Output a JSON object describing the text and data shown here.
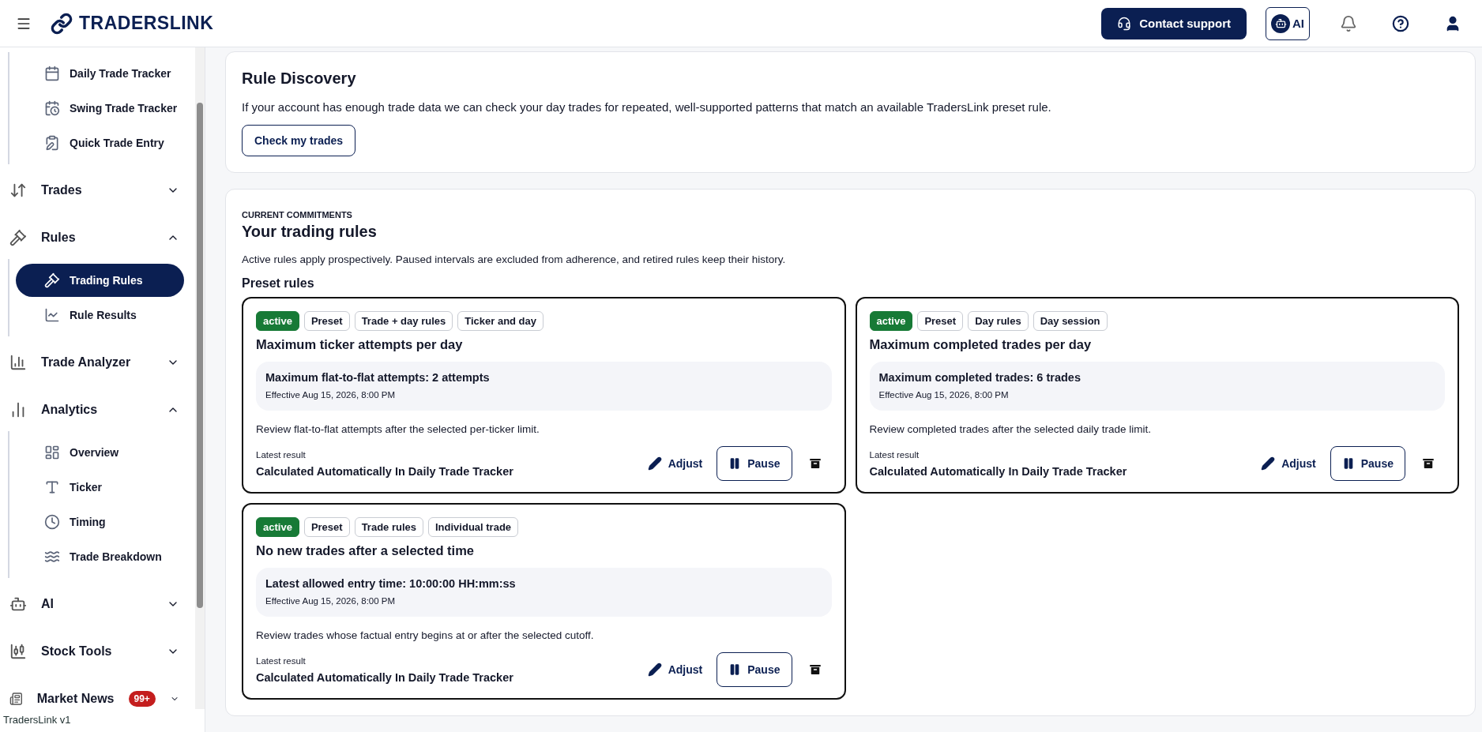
{
  "header": {
    "logo": "TRADERSLINK",
    "contact_button": "Contact support",
    "ai_button": "AI"
  },
  "sidebar": {
    "sections": [
      {
        "children": [
          {
            "label": "Daily Trade Tracker",
            "selected": false
          },
          {
            "label": "Swing Trade Tracker",
            "selected": false
          },
          {
            "label": "Quick Trade Entry",
            "selected": false
          }
        ]
      },
      {
        "label": "Trades",
        "expanded": false
      },
      {
        "label": "Rules",
        "expanded": true,
        "children": [
          {
            "label": "Trading Rules",
            "selected": true
          },
          {
            "label": "Rule Results",
            "selected": false
          }
        ]
      },
      {
        "label": "Trade Analyzer",
        "expanded": false
      },
      {
        "label": "Analytics",
        "expanded": true,
        "children": [
          {
            "label": "Overview",
            "selected": false
          },
          {
            "label": "Ticker",
            "selected": false
          },
          {
            "label": "Timing",
            "selected": false
          },
          {
            "label": "Trade Breakdown",
            "selected": false
          }
        ]
      },
      {
        "label": "AI",
        "expanded": false
      },
      {
        "label": "Stock Tools",
        "expanded": false
      },
      {
        "label": "Market News",
        "expanded": false,
        "badge": "99+"
      }
    ],
    "version": "TradersLink v1"
  },
  "rule_discovery": {
    "title": "Rule Discovery",
    "text": "If your account has enough trade data we can check your day trades for repeated, well-supported patterns that match an available TradersLink preset rule.",
    "button": "Check my trades"
  },
  "commitments": {
    "eyebrow": "CURRENT COMMITMENTS",
    "title": "Your trading rules",
    "text": "Active rules apply prospectively. Paused intervals are excluded from adherence, and retired rules keep their history.",
    "section_title": "Preset rules",
    "rules": [
      {
        "tags": [
          {
            "label": "active",
            "kind": "status"
          },
          {
            "label": "Preset",
            "kind": "tag"
          },
          {
            "label": "Trade + day rules",
            "kind": "tag"
          },
          {
            "label": "Ticker and day",
            "kind": "tag"
          }
        ],
        "title": "Maximum ticker attempts per day",
        "setting": "Maximum flat-to-flat attempts: 2 attempts",
        "effective": "Effective Aug 15, 2026, 8:00 PM",
        "description": "Review flat-to-flat attempts after the selected per-ticker limit.",
        "result_label": "Latest result",
        "result": "Calculated Automatically In Daily Trade Tracker",
        "adjust": "Adjust",
        "pause": "Pause"
      },
      {
        "tags": [
          {
            "label": "active",
            "kind": "status"
          },
          {
            "label": "Preset",
            "kind": "tag"
          },
          {
            "label": "Day rules",
            "kind": "tag"
          },
          {
            "label": "Day session",
            "kind": "tag"
          }
        ],
        "title": "Maximum completed trades per day",
        "setting": "Maximum completed trades: 6 trades",
        "effective": "Effective Aug 15, 2026, 8:00 PM",
        "description": "Review completed trades after the selected daily trade limit.",
        "result_label": "Latest result",
        "result": "Calculated Automatically In Daily Trade Tracker",
        "adjust": "Adjust",
        "pause": "Pause"
      },
      {
        "tags": [
          {
            "label": "active",
            "kind": "status"
          },
          {
            "label": "Preset",
            "kind": "tag"
          },
          {
            "label": "Trade rules",
            "kind": "tag"
          },
          {
            "label": "Individual trade",
            "kind": "tag"
          }
        ],
        "title": "No new trades after a selected time",
        "setting": "Latest allowed entry time: 10:00:00 HH:mm:ss",
        "effective": "Effective Aug 15, 2026, 8:00 PM",
        "description": "Review trades whose factual entry begins at or after the selected cutoff.",
        "result_label": "Latest result",
        "result": "Calculated Automatically In Daily Trade Tracker",
        "adjust": "Adjust",
        "pause": "Pause"
      }
    ]
  }
}
